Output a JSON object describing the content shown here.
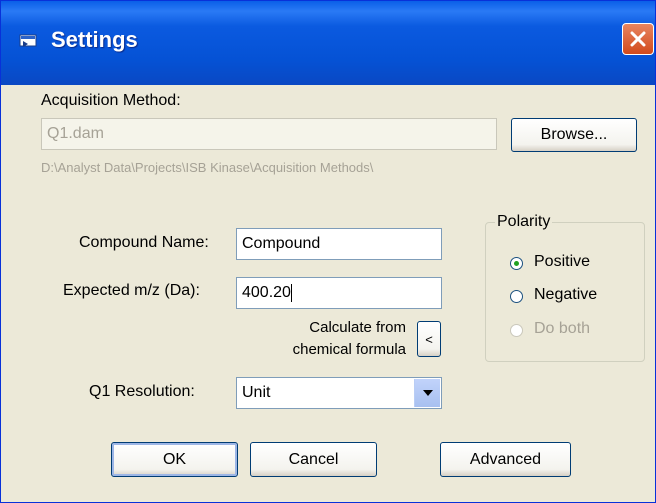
{
  "window": {
    "title": "Settings"
  },
  "acquisition": {
    "label": "Acquisition Method:",
    "value": "Q1.dam",
    "browse_label": "Browse...",
    "path": "D:\\Analyst Data\\Projects\\ISB Kinase\\Acquisition Methods\\"
  },
  "compound": {
    "label": "Compound Name:",
    "value": "Compound"
  },
  "mz": {
    "label": "Expected m/z (Da):",
    "value": "400.20"
  },
  "calculate": {
    "line1": "Calculate from",
    "line2": "chemical formula",
    "button_label": "<"
  },
  "resolution": {
    "label": "Q1 Resolution:",
    "value": "Unit"
  },
  "polarity": {
    "title": "Polarity",
    "selected": "Positive",
    "options": [
      {
        "label": "Positive",
        "checked": true,
        "enabled": true
      },
      {
        "label": "Negative",
        "checked": false,
        "enabled": true
      },
      {
        "label": "Do both",
        "checked": false,
        "enabled": false
      }
    ]
  },
  "buttons": {
    "ok": "OK",
    "cancel": "Cancel",
    "advanced": "Advanced"
  }
}
